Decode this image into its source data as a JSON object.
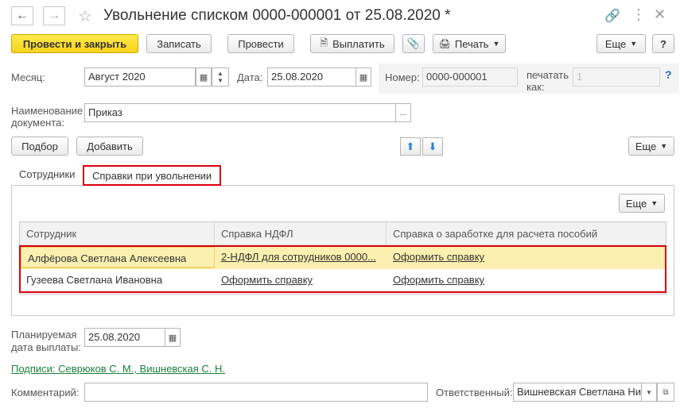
{
  "window": {
    "title": "Увольнение списком 0000-000001 от 25.08.2020 *",
    "nav_back_icon": "arrow-left-icon",
    "nav_forward_icon": "arrow-right-icon",
    "favorite_icon": "star-icon"
  },
  "toolbar": {
    "post_and_close": "Провести и закрыть",
    "save": "Записать",
    "post": "Провести",
    "pay": "Выплатить",
    "print": "Печать",
    "more": "Еще",
    "help": "?"
  },
  "header": {
    "month_label": "Месяц:",
    "month_value": "Август 2020",
    "date_label": "Дата:",
    "date_value": "25.08.2020",
    "number_label": "Номер:",
    "number_value": "0000-000001",
    "print_as_label_1": "печатать",
    "print_as_label_2": "как:",
    "print_as_value": "1",
    "doc_name_label_1": "Наименование",
    "doc_name_label_2": "документа:",
    "doc_name_value": "Приказ",
    "pick_button": "Подбор",
    "add_button": "Добавить",
    "more_button": "Еще"
  },
  "tabs": [
    {
      "label": "Сотрудники"
    },
    {
      "label": "Справки при увольнении"
    }
  ],
  "table": {
    "more_button": "Еще",
    "columns": [
      "Сотрудник",
      "Справка НДФЛ",
      "Справка о заработке для расчета пособий"
    ],
    "rows": [
      {
        "employee": "Алфёрова Светлана Алексеевна",
        "ndfl": "2-НДФЛ для сотрудников 0000...",
        "earnings": "Оформить справку"
      },
      {
        "employee": "Гузеева Светлана Ивановна",
        "ndfl": "Оформить справку",
        "earnings": "Оформить справку"
      }
    ]
  },
  "footer": {
    "planned_label_1": "Планируемая",
    "planned_label_2": "дата выплаты:",
    "planned_value": "25.08.2020",
    "signatures": "Подписи: Севрюков С. М., Вишневская С. Н.",
    "comment_label": "Комментарий:",
    "comment_value": "",
    "responsible_label": "Ответственный:",
    "responsible_value": "Вишневская Светлана Ни"
  },
  "colors": {
    "accent_red": "#d9000d",
    "selected_row": "#fbf0b0",
    "primary_button": "#f7d21a",
    "link_green": "#1a7f3c"
  }
}
